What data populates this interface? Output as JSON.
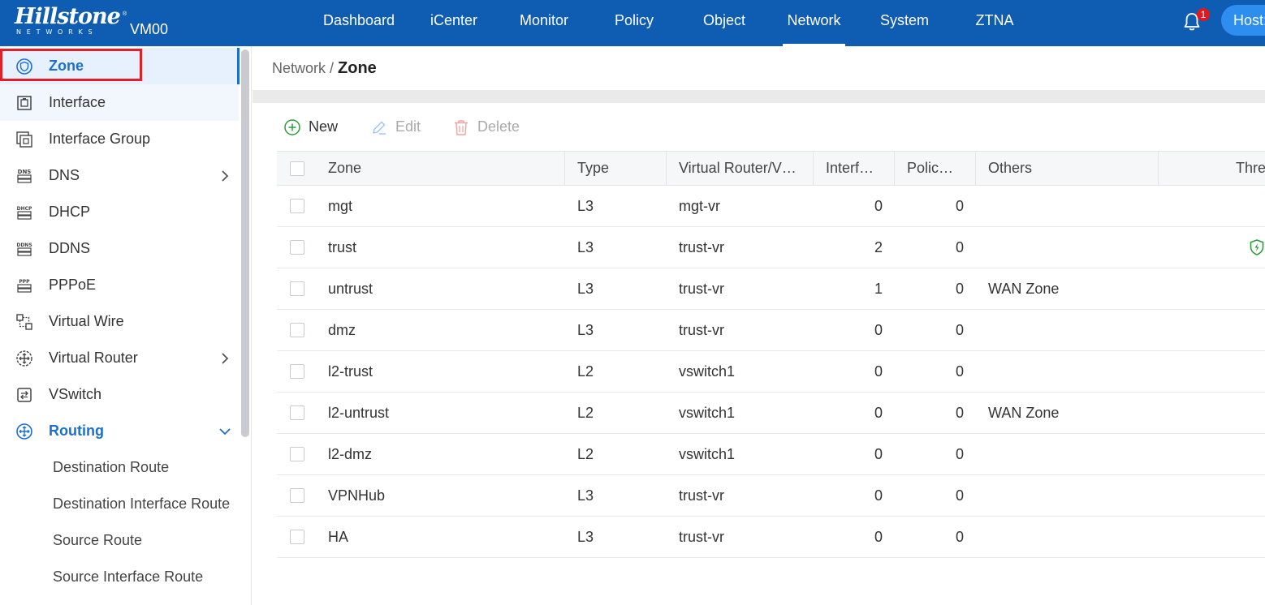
{
  "header": {
    "logo_text": "Hillstone",
    "logo_subtext": "NETWORKS",
    "logo_reg": "®",
    "device_name": "VM00",
    "nav": [
      {
        "label": "Dashboard"
      },
      {
        "label": "iCenter"
      },
      {
        "label": "Monitor"
      },
      {
        "label": "Policy"
      },
      {
        "label": "Object"
      },
      {
        "label": "Network",
        "active": true
      },
      {
        "label": "System"
      },
      {
        "label": "ZTNA"
      }
    ],
    "notification_count": "1",
    "host_label": "Host:",
    "bar_color": "#0f5cb3"
  },
  "sidebar": {
    "items": [
      {
        "label": "Zone",
        "icon": "zone-shield-icon",
        "selected": true
      },
      {
        "label": "Interface",
        "icon": "interface-icon"
      },
      {
        "label": "Interface Group",
        "icon": "interface-group-icon"
      },
      {
        "label": "DNS",
        "icon": "dns-icon",
        "expandable": true
      },
      {
        "label": "DHCP",
        "icon": "dhcp-icon"
      },
      {
        "label": "DDNS",
        "icon": "ddns-icon"
      },
      {
        "label": "PPPoE",
        "icon": "pppoe-icon"
      },
      {
        "label": "Virtual Wire",
        "icon": "virtual-wire-icon"
      },
      {
        "label": "Virtual Router",
        "icon": "virtual-router-icon",
        "expandable": true
      },
      {
        "label": "VSwitch",
        "icon": "vswitch-icon"
      },
      {
        "label": "Routing",
        "icon": "routing-icon",
        "expanded": true
      }
    ],
    "routing_children": [
      {
        "label": "Destination Route"
      },
      {
        "label": "Destination Interface Route"
      },
      {
        "label": "Source Route"
      },
      {
        "label": "Source Interface Route"
      }
    ],
    "accent_color": "#1a6fd0"
  },
  "breadcrumb": {
    "parent": "Network",
    "separator": " / ",
    "current": "Zone"
  },
  "toolbar": {
    "new_label": "New",
    "edit_label": "Edit",
    "delete_label": "Delete"
  },
  "table": {
    "columns": [
      "Zone",
      "Type",
      "Virtual Router/V…",
      "Interf…",
      "Polic…",
      "Others",
      "Thre"
    ],
    "rows": [
      {
        "zone": "mgt",
        "type": "L3",
        "vr": "mgt-vr",
        "interfaces": "0",
        "policies": "0",
        "others": "",
        "threat": false
      },
      {
        "zone": "trust",
        "type": "L3",
        "vr": "trust-vr",
        "interfaces": "2",
        "policies": "0",
        "others": "",
        "threat": true
      },
      {
        "zone": "untrust",
        "type": "L3",
        "vr": "trust-vr",
        "interfaces": "1",
        "policies": "0",
        "others": "WAN Zone",
        "threat": false
      },
      {
        "zone": "dmz",
        "type": "L3",
        "vr": "trust-vr",
        "interfaces": "0",
        "policies": "0",
        "others": "",
        "threat": false
      },
      {
        "zone": "l2-trust",
        "type": "L2",
        "vr": "vswitch1",
        "interfaces": "0",
        "policies": "0",
        "others": "",
        "threat": false
      },
      {
        "zone": "l2-untrust",
        "type": "L2",
        "vr": "vswitch1",
        "interfaces": "0",
        "policies": "0",
        "others": "WAN Zone",
        "threat": false
      },
      {
        "zone": "l2-dmz",
        "type": "L2",
        "vr": "vswitch1",
        "interfaces": "0",
        "policies": "0",
        "others": "",
        "threat": false
      },
      {
        "zone": "VPNHub",
        "type": "L3",
        "vr": "trust-vr",
        "interfaces": "0",
        "policies": "0",
        "others": "",
        "threat": false
      },
      {
        "zone": "HA",
        "type": "L3",
        "vr": "trust-vr",
        "interfaces": "0",
        "policies": "0",
        "others": "",
        "threat": false
      }
    ],
    "threat_icon": "threat-protection-shield-icon",
    "threat_color": "#2a9d3a"
  }
}
